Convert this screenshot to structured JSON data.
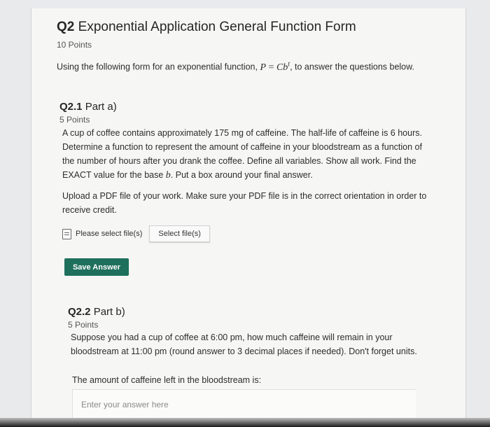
{
  "question": {
    "number": "Q2",
    "title": "Exponential Application General Function Form",
    "points": "10 Points",
    "instruction_pre": "Using the following form for an exponential function,",
    "formula_lhs": "P",
    "formula_eq": " = ",
    "formula_rhs": "Cb",
    "formula_exp": "t",
    "instruction_post": ", to answer the questions below."
  },
  "part_a": {
    "number": "Q2.1",
    "label": "Part a)",
    "points": "5 Points",
    "body_lines": [
      "A cup of coffee contains approximately 175 mg of caffeine. The half-life of caffeine is 6 hours.",
      "Determine a function to represent the amount of caffeine in your bloodstream as a function of",
      "the number of hours after you drank the coffee. Define all variables. Show all work. Find the"
    ],
    "body_last_pre": "EXACT value for the base ",
    "body_last_var": "b",
    "body_last_post": ". Put a box around your final answer.",
    "upload_lines": [
      "Upload a PDF file of your work. Make sure your PDF file is in the correct orientation in order to",
      "receive credit."
    ],
    "file_label": "Please select file(s)",
    "select_button": "Select file(s)",
    "save_button": "Save Answer"
  },
  "part_b": {
    "number": "Q2.2",
    "label": "Part b)",
    "points": "5 Points",
    "body_lines": [
      "Suppose you had a cup of coffee at 6:00 pm, how much caffeine will remain in your",
      "bloodstream at 11:00 pm (round answer to 3 decimal places if needed). Don't forget units."
    ],
    "answer_prompt": "The amount of caffeine left in the bloodstream is:",
    "answer_placeholder": "Enter your answer here"
  }
}
